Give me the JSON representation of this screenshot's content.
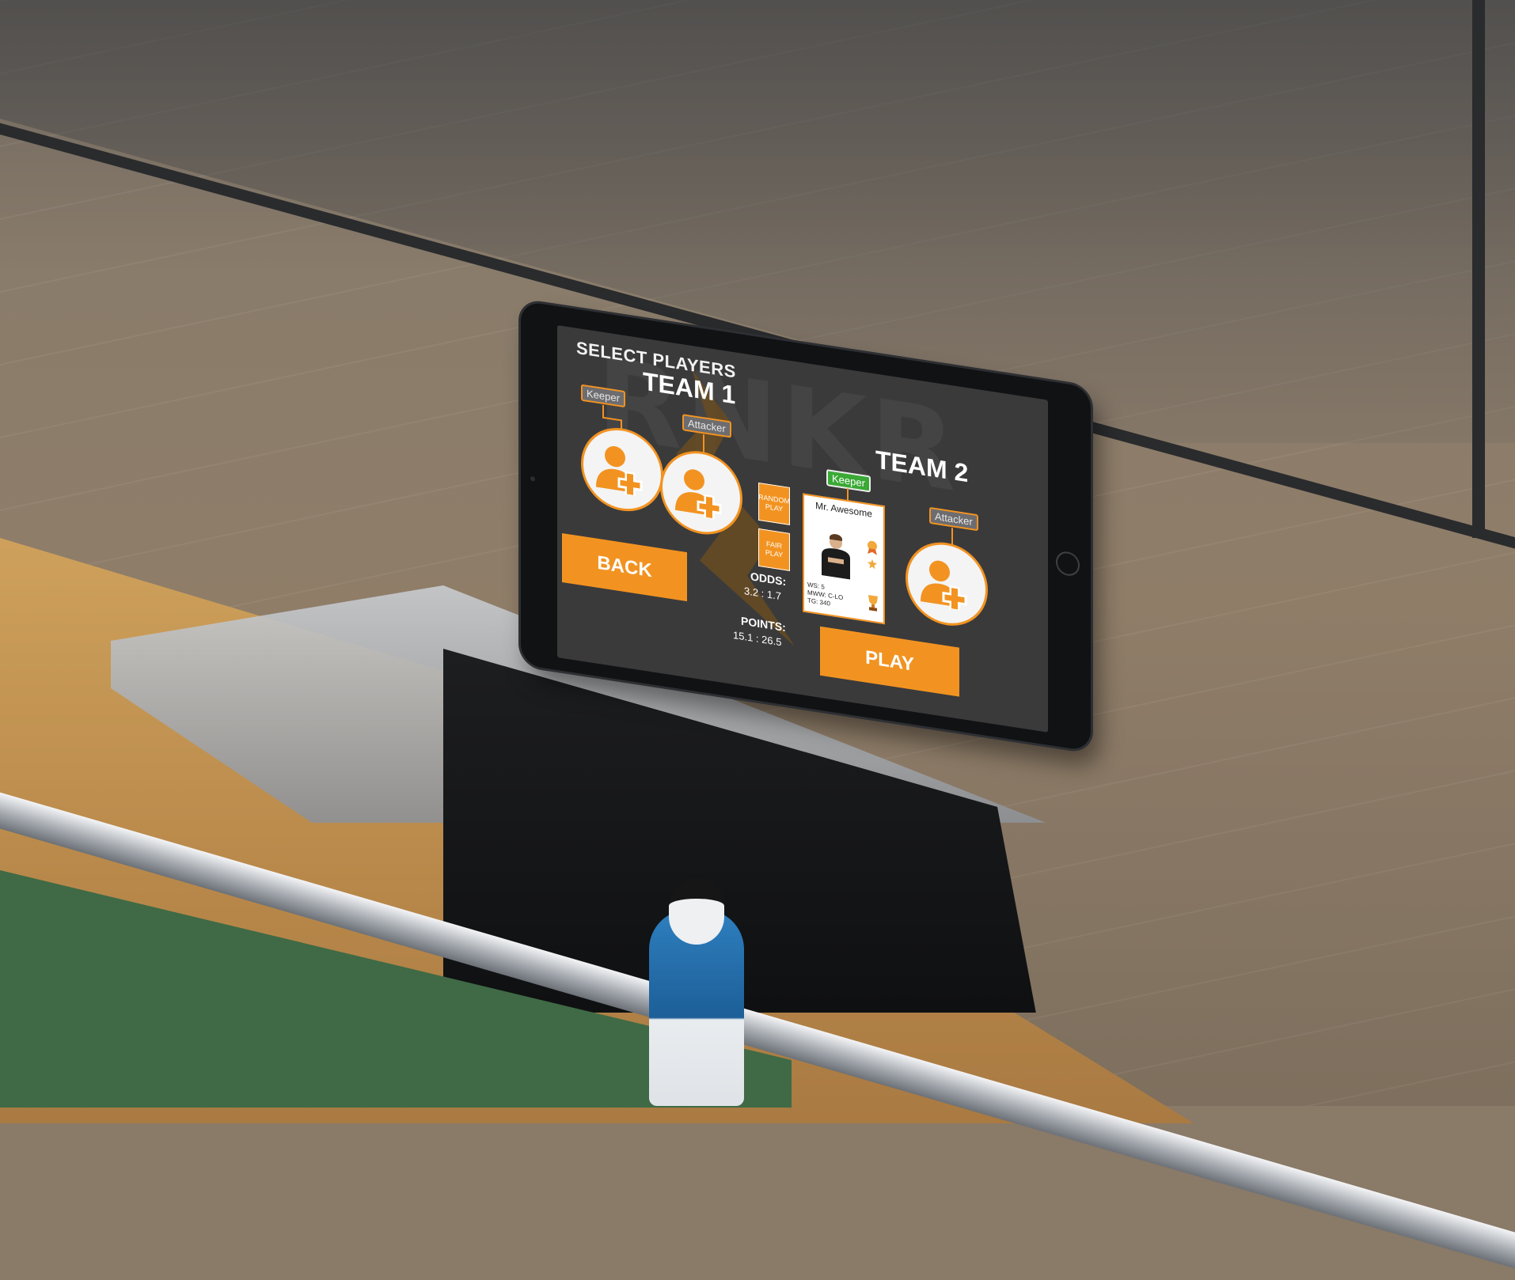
{
  "screen": {
    "title": "SELECT PLAYERS",
    "watermark": "RNKR"
  },
  "team1": {
    "title": "TEAM 1",
    "keeper_label": "Keeper",
    "attacker_label": "Attacker"
  },
  "team2": {
    "title": "TEAM 2",
    "keeper_label": "Keeper",
    "attacker_label": "Attacker",
    "keeper_player": {
      "name": "Mr. Awesome",
      "stats": [
        "WS: 5",
        "MWW: C-LO",
        "TG: 340"
      ]
    }
  },
  "controls": {
    "random_play": "RANDOM PLAY",
    "fair_play": "FAIR PLAY",
    "back": "BACK",
    "play": "PLAY"
  },
  "odds": {
    "label": "ODDS:",
    "value": "3.2 : 1.7"
  },
  "points": {
    "label": "POINTS:",
    "value": "15.1 : 26.5"
  },
  "colors": {
    "accent": "#f29321",
    "screen_bg": "#3a3a3b",
    "active_tag": "#3aa935"
  },
  "icons": [
    "add-user-icon",
    "award-icon",
    "star-icon",
    "trophy-icon",
    "home-button-icon"
  ]
}
